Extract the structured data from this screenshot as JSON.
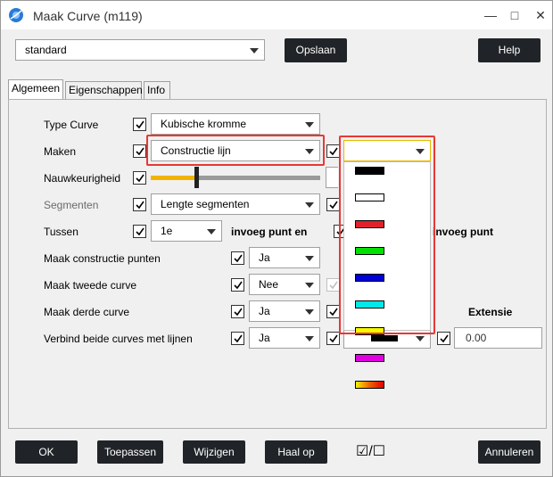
{
  "window": {
    "title": "Maak Curve (m119)",
    "controls": {
      "minimize": "—",
      "maximize": "□",
      "close": "✕"
    }
  },
  "toolbar": {
    "preset_value": "standard",
    "save_label": "Opslaan",
    "help_label": "Help"
  },
  "tabs": [
    {
      "label": "Algemeen"
    },
    {
      "label": "Eigenschappen"
    },
    {
      "label": "Info"
    }
  ],
  "rows": {
    "type_curve": {
      "label": "Type Curve",
      "value": "Kubische kromme"
    },
    "maken": {
      "label": "Maken",
      "value": "Constructie lijn"
    },
    "nauwkeurigheid": {
      "label": "Nauwkeurigheid",
      "slider_fraction": 0.27
    },
    "segmenten": {
      "label": "Segmenten",
      "value": "Lengte segmenten"
    },
    "tussen": {
      "label": "Tussen",
      "value": "1e",
      "suffix": "invoeg punt en",
      "suffix2": "invoeg punt"
    },
    "constructie_punten": {
      "label": "Maak constructie punten",
      "value": "Ja"
    },
    "tweede_curve": {
      "label": "Maak tweede curve",
      "value": "Nee"
    },
    "derde_curve": {
      "label": "Maak derde curve",
      "value": "Ja",
      "extensie_label": "Extensie"
    },
    "verbind": {
      "label": "Verbind beide curves met lijnen",
      "value": "Ja",
      "extensie_value": "0.00"
    }
  },
  "color_dropdown": {
    "colors": [
      "#000000",
      "#ffffff",
      "#e0202a",
      "#00e000",
      "#0000d8",
      "#00e8e8",
      "#f8f800",
      "#e000e0",
      "gradient"
    ],
    "selected_value": ""
  },
  "footer": {
    "ok": "OK",
    "apply": "Toepassen",
    "change": "Wijzigen",
    "fetch": "Haal op",
    "toggle_text": "☑/☐",
    "cancel": "Annuleren"
  }
}
